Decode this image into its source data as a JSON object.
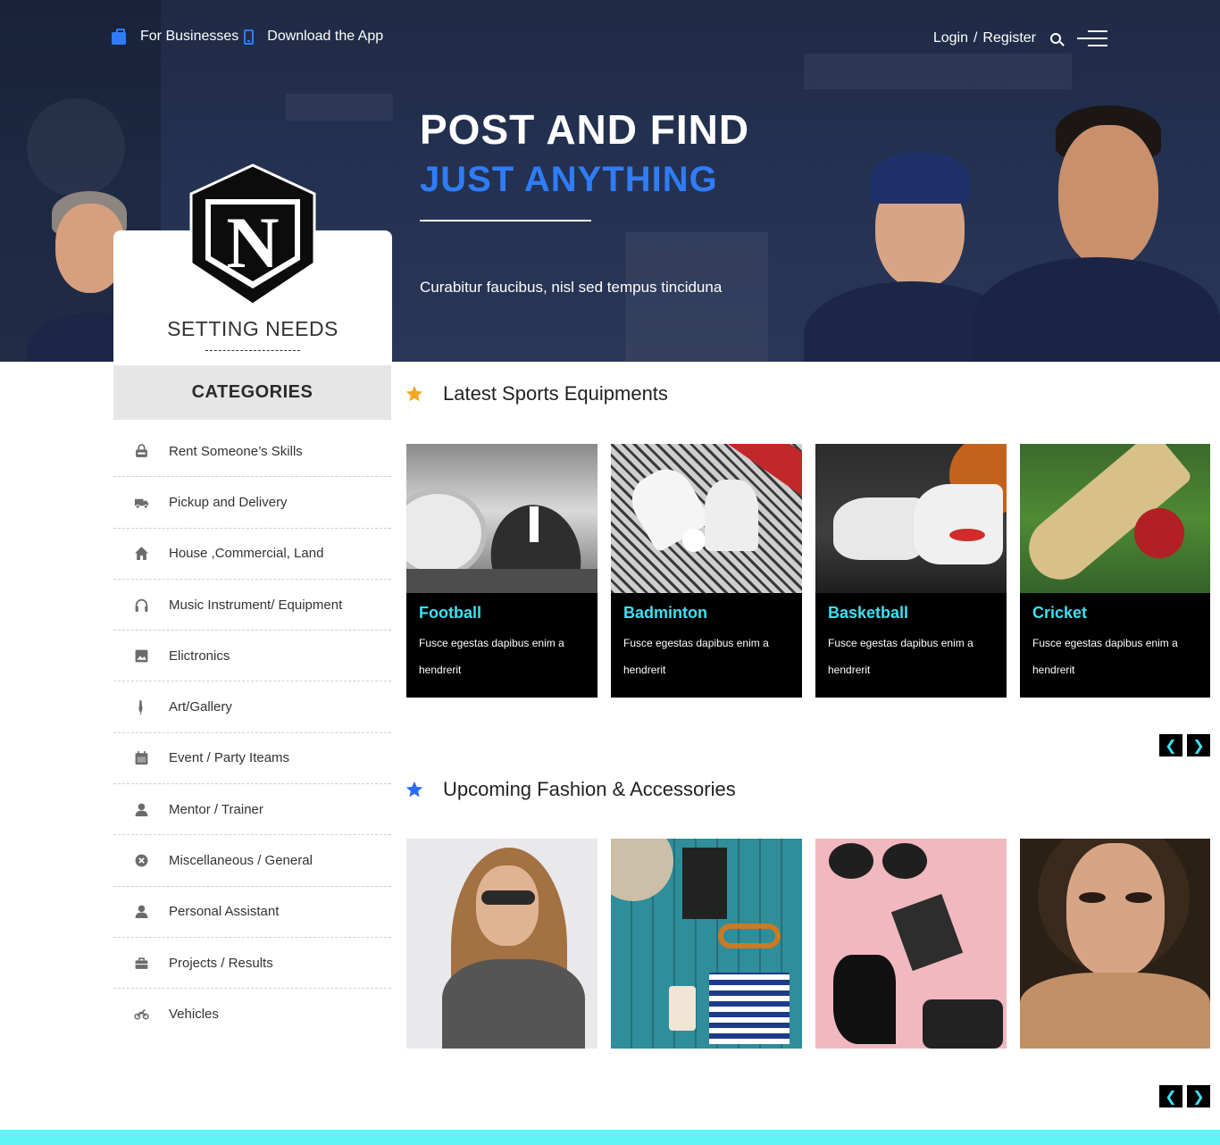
{
  "topbar": {
    "for_businesses": "For Businesses",
    "download_app": "Download the App",
    "login": "Login",
    "separator": "/",
    "register": "Register"
  },
  "hero": {
    "headline_line1": "POST AND FIND",
    "headline_line2": "JUST ANYTHING",
    "tagline": "Curabitur faucibus, nisl sed tempus tinciduna"
  },
  "brand": {
    "name": "SETTING NEEDS",
    "logo_letter": "N"
  },
  "sidebar": {
    "heading": "CATEGORIES",
    "items": [
      {
        "label": "Rent Someone’s Skills",
        "icon": "rent-icon"
      },
      {
        "label": "Pickup and Delivery",
        "icon": "truck-icon"
      },
      {
        "label": "House ,Commercial, Land",
        "icon": "home-icon"
      },
      {
        "label": "Music Instrument/ Equipment",
        "icon": "headphones-icon"
      },
      {
        "label": "Elictronics",
        "icon": "image-icon"
      },
      {
        "label": "Art/Gallery",
        "icon": "brush-icon"
      },
      {
        "label": "Event / Party Iteams",
        "icon": "calendar-icon"
      },
      {
        "label": "Mentor / Trainer",
        "icon": "user-icon"
      },
      {
        "label": "Miscellaneous / General",
        "icon": "close-circle-icon"
      },
      {
        "label": "Personal Assistant",
        "icon": "user-icon"
      },
      {
        "label": "Projects / Results",
        "icon": "briefcase-icon"
      },
      {
        "label": "Vehicles",
        "icon": "motorbike-icon"
      }
    ]
  },
  "sports": {
    "title": "Latest Sports Equipments",
    "star_color": "#f5a623",
    "cards": [
      {
        "title": "Football",
        "desc": "Fusce egestas dapibus enim a hendrerit"
      },
      {
        "title": "Badminton",
        "desc": "Fusce egestas dapibus enim a hendrerit"
      },
      {
        "title": "Basketball",
        "desc": "Fusce egestas dapibus enim a hendrerit"
      },
      {
        "title": "Cricket",
        "desc": "Fusce egestas dapibus enim a hendrerit"
      }
    ],
    "prev": "❮",
    "next": "❯"
  },
  "fashion": {
    "title": "Upcoming Fashion & Accessories",
    "star_color": "#2f6cf6",
    "prev": "❮",
    "next": "❯"
  },
  "colors": {
    "accent_blue": "#2f7cf6",
    "accent_cyan": "#3ee0f0",
    "footer_cyan": "#5ef3f5"
  }
}
